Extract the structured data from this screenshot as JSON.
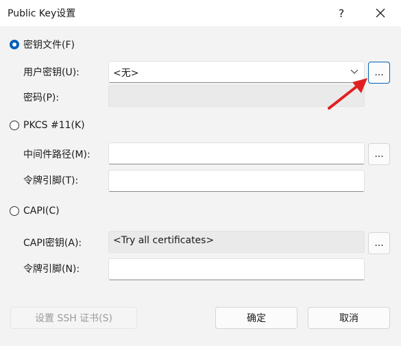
{
  "window": {
    "title": "Public Key设置",
    "help_label": "?",
    "close_icon": "close-icon"
  },
  "keyfile": {
    "radio_label": "密钥文件(F)",
    "selected": true,
    "user_key_label": "用户密钥(U):",
    "user_key_value": "<无>",
    "browse_label": "...",
    "password_label": "密码(P):",
    "password_value": ""
  },
  "pkcs11": {
    "radio_label": "PKCS #11(K)",
    "selected": false,
    "middleware_label": "中间件路径(M):",
    "middleware_value": "",
    "browse_label": "...",
    "token_pin_label": "令牌引脚(T):",
    "token_pin_value": ""
  },
  "capi": {
    "radio_label": "CAPI(C)",
    "selected": false,
    "capi_key_label": "CAPI密钥(A):",
    "capi_key_value": "<Try all certificates>",
    "browse_label": "...",
    "token_pin_label": "令牌引脚(N):",
    "token_pin_value": ""
  },
  "buttons": {
    "ssh_cert_label": "设置 SSH 证书(S)",
    "ok_label": "确定",
    "cancel_label": "取消"
  },
  "colors": {
    "accent": "#005fb8",
    "annotation_arrow": "#e02020"
  }
}
